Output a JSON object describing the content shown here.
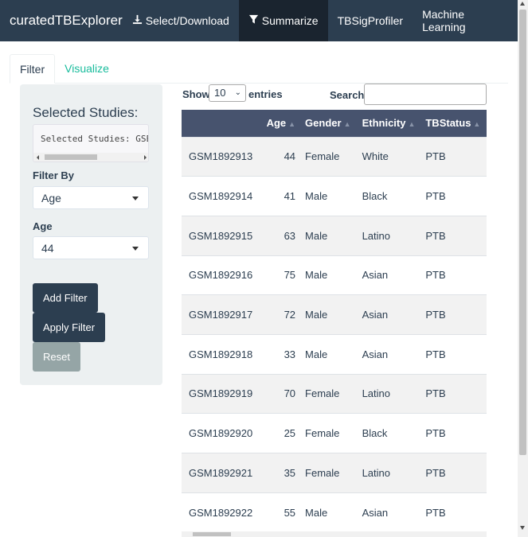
{
  "navbar": {
    "brand": "curatedTBExplorer",
    "items": [
      {
        "label": "Select/Download",
        "icon": "download-icon"
      },
      {
        "label": "Summarize",
        "icon": "filter-icon",
        "active": true
      },
      {
        "label": "TBSigProfiler"
      },
      {
        "label": "Machine Learning"
      }
    ],
    "colors": {
      "background": "#2c3e50",
      "active": "#1a242f"
    }
  },
  "tabs": [
    {
      "label": "Filter",
      "active": true
    },
    {
      "label": "Visualize",
      "active": false
    }
  ],
  "sidebar": {
    "title": "Selected Studies:",
    "studies_text": "Selected Studies:  GSE",
    "filter_by_label": "Filter By",
    "filter_by_value": "Age",
    "age_label": "Age",
    "age_value": "44",
    "buttons": {
      "add": "Add Filter",
      "apply": "Apply Filter",
      "reset": "Reset"
    }
  },
  "table_controls": {
    "show_label": "Show",
    "length_value": "10",
    "entries_label": "entries",
    "search_label": "Search:",
    "search_value": ""
  },
  "table": {
    "columns": [
      "",
      "Age",
      "Gender",
      "Ethnicity",
      "TBStatus"
    ],
    "rows": [
      [
        "GSM1892913",
        "44",
        "Female",
        "White",
        "PTB"
      ],
      [
        "GSM1892914",
        "41",
        "Male",
        "Black",
        "PTB"
      ],
      [
        "GSM1892915",
        "63",
        "Male",
        "Latino",
        "PTB"
      ],
      [
        "GSM1892916",
        "75",
        "Male",
        "Asian",
        "PTB"
      ],
      [
        "GSM1892917",
        "72",
        "Male",
        "Asian",
        "PTB"
      ],
      [
        "GSM1892918",
        "33",
        "Male",
        "Asian",
        "PTB"
      ],
      [
        "GSM1892919",
        "70",
        "Female",
        "Latino",
        "PTB"
      ],
      [
        "GSM1892920",
        "25",
        "Female",
        "Black",
        "PTB"
      ],
      [
        "GSM1892921",
        "35",
        "Female",
        "Latino",
        "PTB"
      ],
      [
        "GSM1892922",
        "55",
        "Male",
        "Asian",
        "PTB"
      ]
    ],
    "header_color": "#47536e"
  }
}
